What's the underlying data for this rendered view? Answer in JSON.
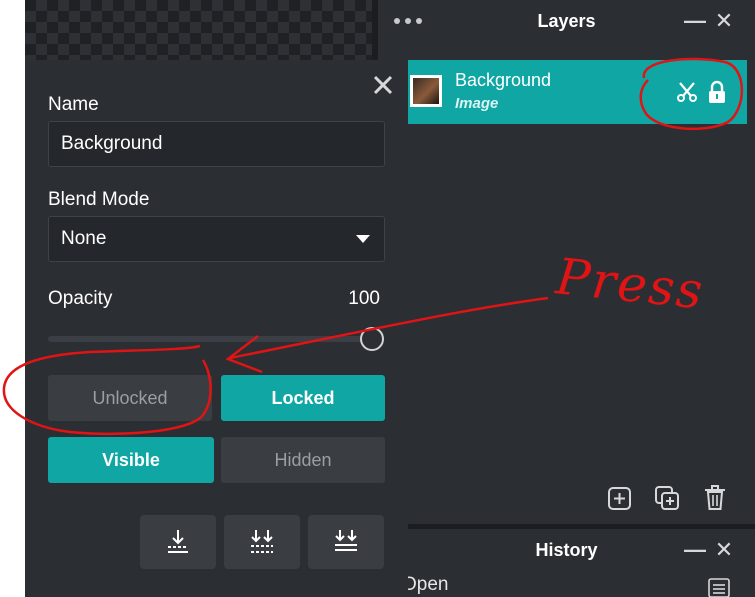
{
  "layers_panel": {
    "title": "Layers",
    "minimize_glyph": "—",
    "close_glyph": "✕",
    "layer": {
      "name": "Background",
      "type": "Image",
      "icons": [
        "scissors-icon",
        "lock-icon"
      ]
    },
    "footer_icons": [
      "add-layer-icon",
      "duplicate-layer-icon",
      "delete-layer-icon"
    ],
    "accent_color": "#0fa6a4"
  },
  "history_panel": {
    "title": "History",
    "minimize_glyph": "—",
    "close_glyph": "✕",
    "first_item": "Open"
  },
  "properties": {
    "name_label": "Name",
    "name_value": "Background",
    "blend_label": "Blend Mode",
    "blend_value": "None",
    "opacity_label": "Opacity",
    "opacity_value": "100",
    "opacity_level": 1.0,
    "lock_options": {
      "off": "Unlocked",
      "on": "Locked",
      "selected": "Locked"
    },
    "visibility_options": {
      "on": "Visible",
      "off": "Hidden",
      "selected": "Visible"
    },
    "merge_icons": [
      "merge-down-icon",
      "merge-visible-icon",
      "flatten-icon"
    ]
  },
  "annotation": {
    "text": "Press",
    "color": "#e01414"
  }
}
